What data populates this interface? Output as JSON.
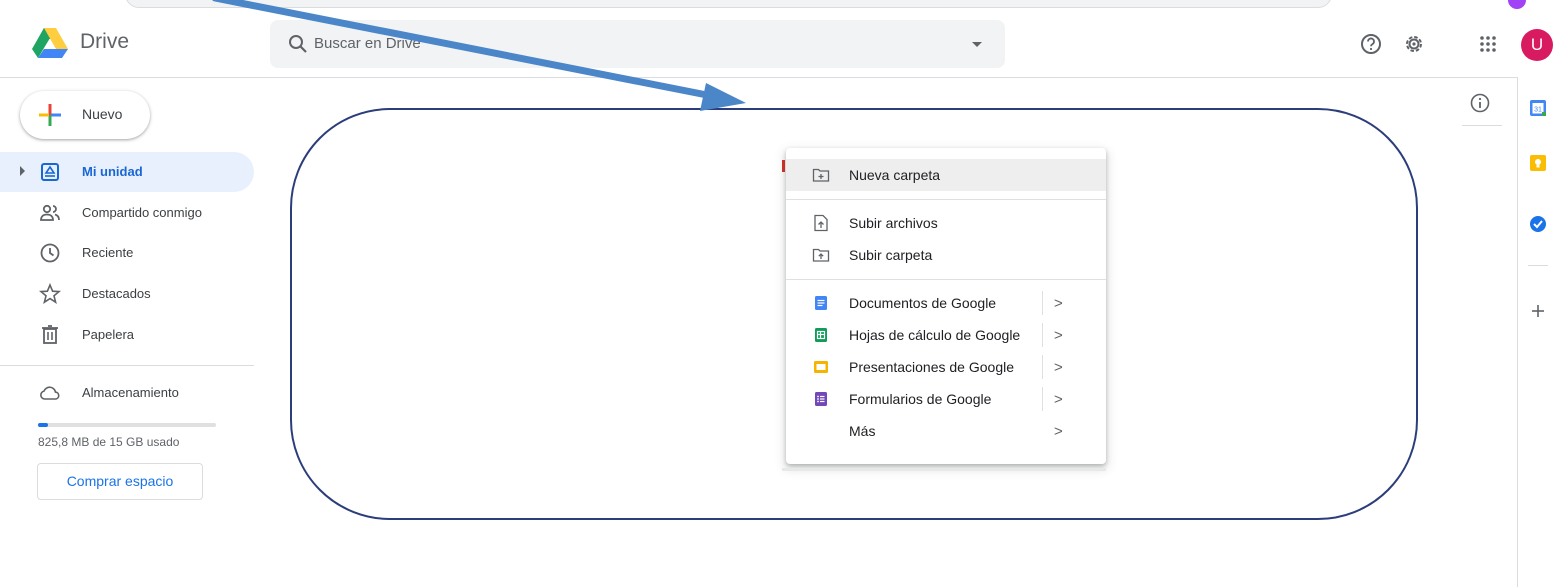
{
  "app": {
    "name": "Drive"
  },
  "search": {
    "placeholder": "Buscar en Drive"
  },
  "user": {
    "initial": "U"
  },
  "new_button": {
    "label": "Nuevo"
  },
  "sidebar": {
    "items": [
      {
        "label": "Mi unidad",
        "icon": "my-drive-icon",
        "active": true
      },
      {
        "label": "Compartido conmigo",
        "icon": "shared-icon"
      },
      {
        "label": "Reciente",
        "icon": "clock-icon"
      },
      {
        "label": "Destacados",
        "icon": "star-icon"
      },
      {
        "label": "Papelera",
        "icon": "trash-icon"
      }
    ],
    "storage": {
      "label": "Almacenamiento",
      "usage_text": "825,8 MB de 15 GB usado",
      "used_fraction": 0.054,
      "buy_label": "Comprar espacio"
    }
  },
  "side_panel": {
    "calendar_day": "31"
  },
  "menu": {
    "items": [
      {
        "label": "Nueva carpeta",
        "icon": "new-folder-icon"
      },
      {
        "label": "Subir archivos",
        "icon": "file-upload-icon"
      },
      {
        "label": "Subir carpeta",
        "icon": "folder-upload-icon"
      },
      {
        "label": "Documentos de Google",
        "icon": "docs-icon",
        "submenu": true
      },
      {
        "label": "Hojas de cálculo de Google",
        "icon": "sheets-icon",
        "submenu": true
      },
      {
        "label": "Presentaciones de Google",
        "icon": "slides-icon",
        "submenu": true
      },
      {
        "label": "Formularios de Google",
        "icon": "forms-icon",
        "submenu": true
      },
      {
        "label": "Más",
        "submenu": true
      }
    ],
    "chevron": ">"
  },
  "colors": {
    "accent": "#1a73e8",
    "annotation_arrow": "#4a86c8",
    "annotation_outline": "#2b3d7a"
  }
}
